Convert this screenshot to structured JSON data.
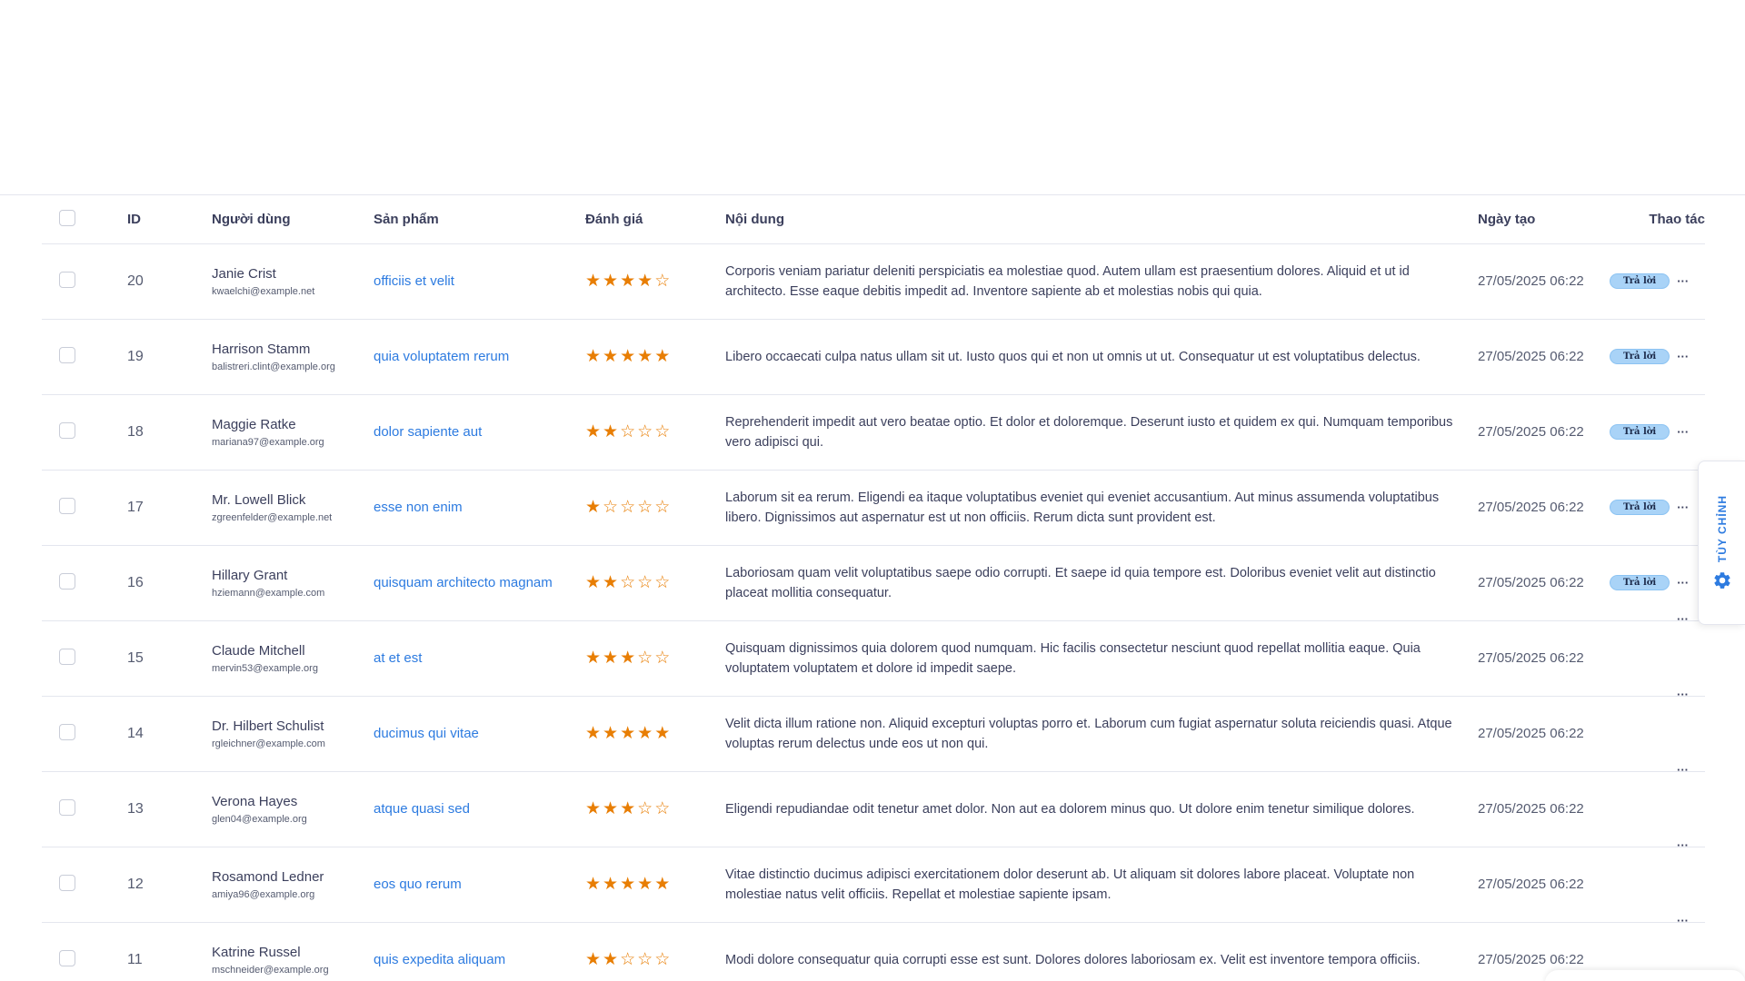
{
  "table": {
    "headers": {
      "id": "ID",
      "user": "Người dùng",
      "product": "Sản phẩm",
      "rating": "Đánh giá",
      "content": "Nội dung",
      "created": "Ngày tạo",
      "actions": "Thao tác"
    },
    "reply_label": "Trả lời",
    "more_label": "···",
    "rows": [
      {
        "id": "20",
        "name": "Janie Crist",
        "email": "kwaelchi@example.net",
        "product": "officiis et velit",
        "rating": 4,
        "content": "Corporis veniam pariatur deleniti perspiciatis ea molestiae quod. Autem ullam est praesentium dolores. Aliquid et ut id architecto. Esse eaque debitis impedit ad. Inventore sapiente ab et molestias nobis qui quia.",
        "date": "27/05/2025 06:22",
        "has_reply": true
      },
      {
        "id": "19",
        "name": "Harrison Stamm",
        "email": "balistreri.clint@example.org",
        "product": "quia voluptatem rerum",
        "rating": 5,
        "content": "Libero occaecati culpa natus ullam sit ut. Iusto quos qui et non ut omnis ut ut. Consequatur ut est voluptatibus delectus.",
        "date": "27/05/2025 06:22",
        "has_reply": true
      },
      {
        "id": "18",
        "name": "Maggie Ratke",
        "email": "mariana97@example.org",
        "product": "dolor sapiente aut",
        "rating": 2,
        "content": "Reprehenderit impedit aut vero beatae optio. Et dolor et doloremque. Deserunt iusto et quidem ex qui. Numquam temporibus vero adipisci qui.",
        "date": "27/05/2025 06:22",
        "has_reply": true
      },
      {
        "id": "17",
        "name": "Mr. Lowell Blick",
        "email": "zgreenfelder@example.net",
        "product": "esse non enim",
        "rating": 1,
        "content": "Laborum sit ea rerum. Eligendi ea itaque voluptatibus eveniet qui eveniet accusantium. Aut minus assumenda voluptatibus libero. Dignissimos aut aspernatur est ut non officiis. Rerum dicta sunt provident est.",
        "date": "27/05/2025 06:22",
        "has_reply": true
      },
      {
        "id": "16",
        "name": "Hillary Grant",
        "email": "hziemann@example.com",
        "product": "quisquam architecto magnam",
        "rating": 2,
        "content": "Laboriosam quam velit voluptatibus saepe odio corrupti. Et saepe id quia tempore est. Doloribus eveniet velit aut distinctio placeat mollitia consequatur.",
        "date": "27/05/2025 06:22",
        "has_reply": true
      },
      {
        "id": "15",
        "name": "Claude Mitchell",
        "email": "mervin53@example.org",
        "product": "at et est",
        "rating": 3,
        "content": "Quisquam dignissimos quia dolorem quod numquam. Hic facilis consectetur nesciunt quod repellat mollitia eaque. Quia voluptatem voluptatem et dolore id impedit saepe.",
        "date": "27/05/2025 06:22",
        "has_reply": false
      },
      {
        "id": "14",
        "name": "Dr. Hilbert Schulist",
        "email": "rgleichner@example.com",
        "product": "ducimus qui vitae",
        "rating": 5,
        "content": "Velit dicta illum ratione non. Aliquid excepturi voluptas porro et. Laborum cum fugiat aspernatur soluta reiciendis quasi. Atque voluptas rerum delectus unde eos ut non qui.",
        "date": "27/05/2025 06:22",
        "has_reply": false
      },
      {
        "id": "13",
        "name": "Verona Hayes",
        "email": "glen04@example.org",
        "product": "atque quasi sed",
        "rating": 3,
        "content": "Eligendi repudiandae odit tenetur amet dolor. Non aut ea dolorem minus quo. Ut dolore enim tenetur similique dolores.",
        "date": "27/05/2025 06:22",
        "has_reply": false
      },
      {
        "id": "12",
        "name": "Rosamond Ledner",
        "email": "amiya96@example.org",
        "product": "eos quo rerum",
        "rating": 5,
        "content": "Vitae distinctio ducimus adipisci exercitationem dolor deserunt ab. Ut aliquam sit dolores labore placeat. Voluptate non molestiae natus velit officiis. Repellat et molestiae sapiente ipsam.",
        "date": "27/05/2025 06:22",
        "has_reply": false
      },
      {
        "id": "11",
        "name": "Katrine Russel",
        "email": "mschneider@example.org",
        "product": "quis expedita aliquam",
        "rating": 2,
        "content": "Modi dolore consequatur quia corrupti esse est sunt. Dolores dolores laboriosam ex. Velit est inventore tempora officiis.",
        "date": "27/05/2025 06:22",
        "has_reply": false
      }
    ]
  },
  "customize": {
    "label": "TÙY CHỈNH",
    "icon": "gear-icon",
    "color": "#2d7be0"
  },
  "colors": {
    "star": "#e87e04",
    "link": "#2d7be0",
    "badge": "#a9d3f7"
  }
}
